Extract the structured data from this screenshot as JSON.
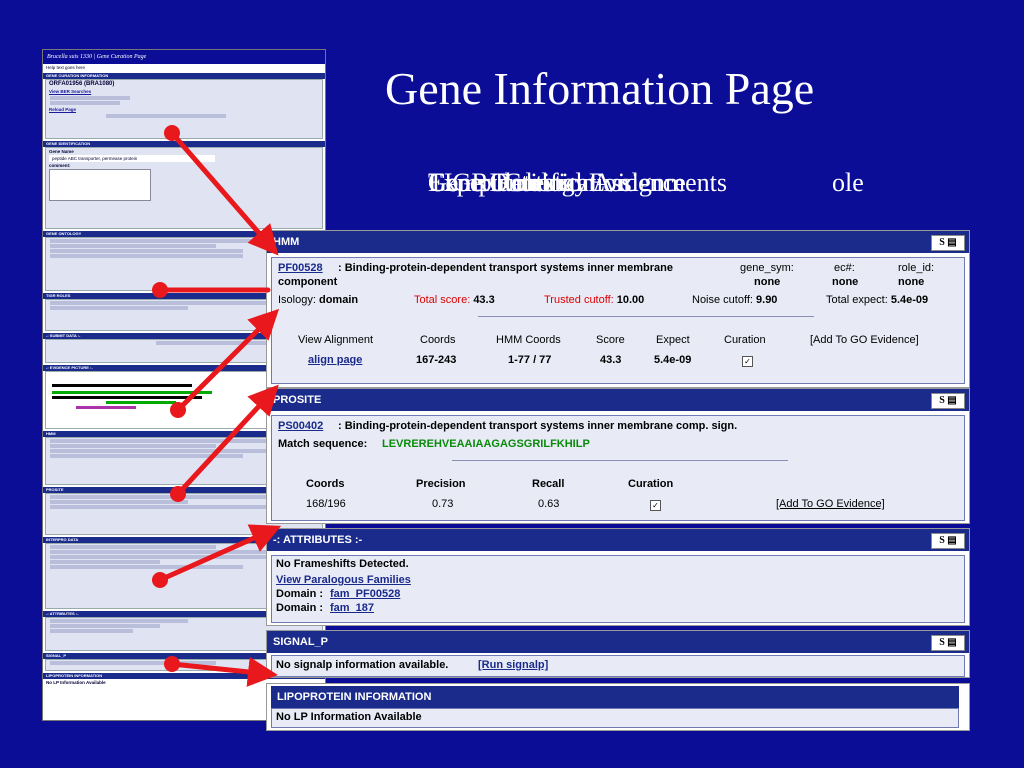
{
  "slide": {
    "title": "Gene Information Page",
    "overlap_texts": [
      "Gene Identification",
      "Gene Ontology Assignments",
      "TIGR Roles",
      "Computational Evidence",
      "Expert Curation"
    ],
    "overlap_suffix": "ole"
  },
  "thumb": {
    "window_title": "Brucella suis 1330 | Gene Curation Page",
    "help": "Help text goes here",
    "gene_curation_info": "GENE CURATION INFORMATION",
    "locus": "ORFA01956 (BRA1080)",
    "links": [
      "View BER Searches",
      "Reload Page"
    ],
    "gene_identification": "GENE IDENTIFICATION",
    "gene_name_label": "Gene Name",
    "gene_symbol_label": "Gene Symbol",
    "ec_label": "EC Number",
    "gene_name": "peptide ABC transporter, permease protein",
    "comment_label": "comment:",
    "gene_ontology": "GENE ONTOLOGY",
    "tigr_roles": "TIGR ROLES",
    "submit": "-: SUBMIT DATA :-",
    "evidence": "-: EVIDENCE PICTURE :-",
    "hmm": "HMM",
    "prosite": "PROSITE",
    "interpro": "INTERPRO DATA",
    "attributes": "-: ATTRIBUTES :-",
    "signal": "SIGNAL_P",
    "lipo": "LIPOPROTEIN INFORMATION",
    "no_lp": "No LP Information Available"
  },
  "hmm": {
    "header": "HMM",
    "s_label": "S",
    "accession": "PF00528",
    "desc": "Binding-protein-dependent transport systems inner membrane",
    "desc2": "component",
    "gene_sym_label": "gene_sym:",
    "gene_sym": "none",
    "ec_label": "ec#:",
    "ec": "none",
    "role_label": "role_id:",
    "role": "none",
    "isology_label": "Isology:",
    "isology": "domain",
    "total_score_label": "Total score:",
    "total_score": "43.3",
    "trusted_label": "Trusted cutoff:",
    "trusted": "10.00",
    "noise_label": "Noise cutoff:",
    "noise": "9.90",
    "expect_label": "Total expect:",
    "expect": "5.4e-09",
    "cols": [
      "View Alignment",
      "Coords",
      "HMM Coords",
      "Score",
      "Expect",
      "Curation",
      "[Add To GO Evidence]"
    ],
    "row": [
      "align page",
      "167-243",
      "1-77 / 77",
      "43.3",
      "5.4e-09"
    ]
  },
  "prosite": {
    "header": "PROSITE",
    "s_label": "S",
    "accession": "PS00402",
    "desc": "Binding-protein-dependent transport systems inner membrane comp. sign.",
    "match_label": "Match sequence:",
    "match": "LEVREREHVEAAIAAGAGSGRILFKHILP",
    "cols": [
      "Coords",
      "Precision",
      "Recall",
      "Curation"
    ],
    "row": [
      "168/196",
      "0.73",
      "0.63"
    ],
    "add_go": "[Add To GO Evidence]"
  },
  "attributes": {
    "header": "-: ATTRIBUTES :-",
    "s_label": "S",
    "frameshift": "No Frameshifts Detected.",
    "paralog": "View Paralogous Families",
    "domain_label": "Domain :",
    "domain1": "fam_PF00528",
    "domain2": "fam_187"
  },
  "signal": {
    "header": "SIGNAL_P",
    "s_label": "S",
    "text": "No signalp information available.",
    "link": "[Run signalp]"
  },
  "lipo": {
    "header": "LIPOPROTEIN INFORMATION",
    "text": "No LP Information Available"
  },
  "colors": {
    "background": "#0b0d96",
    "arrow": "#e8181c",
    "bar": "#1b2b8c",
    "match": "#0a8a0a"
  }
}
